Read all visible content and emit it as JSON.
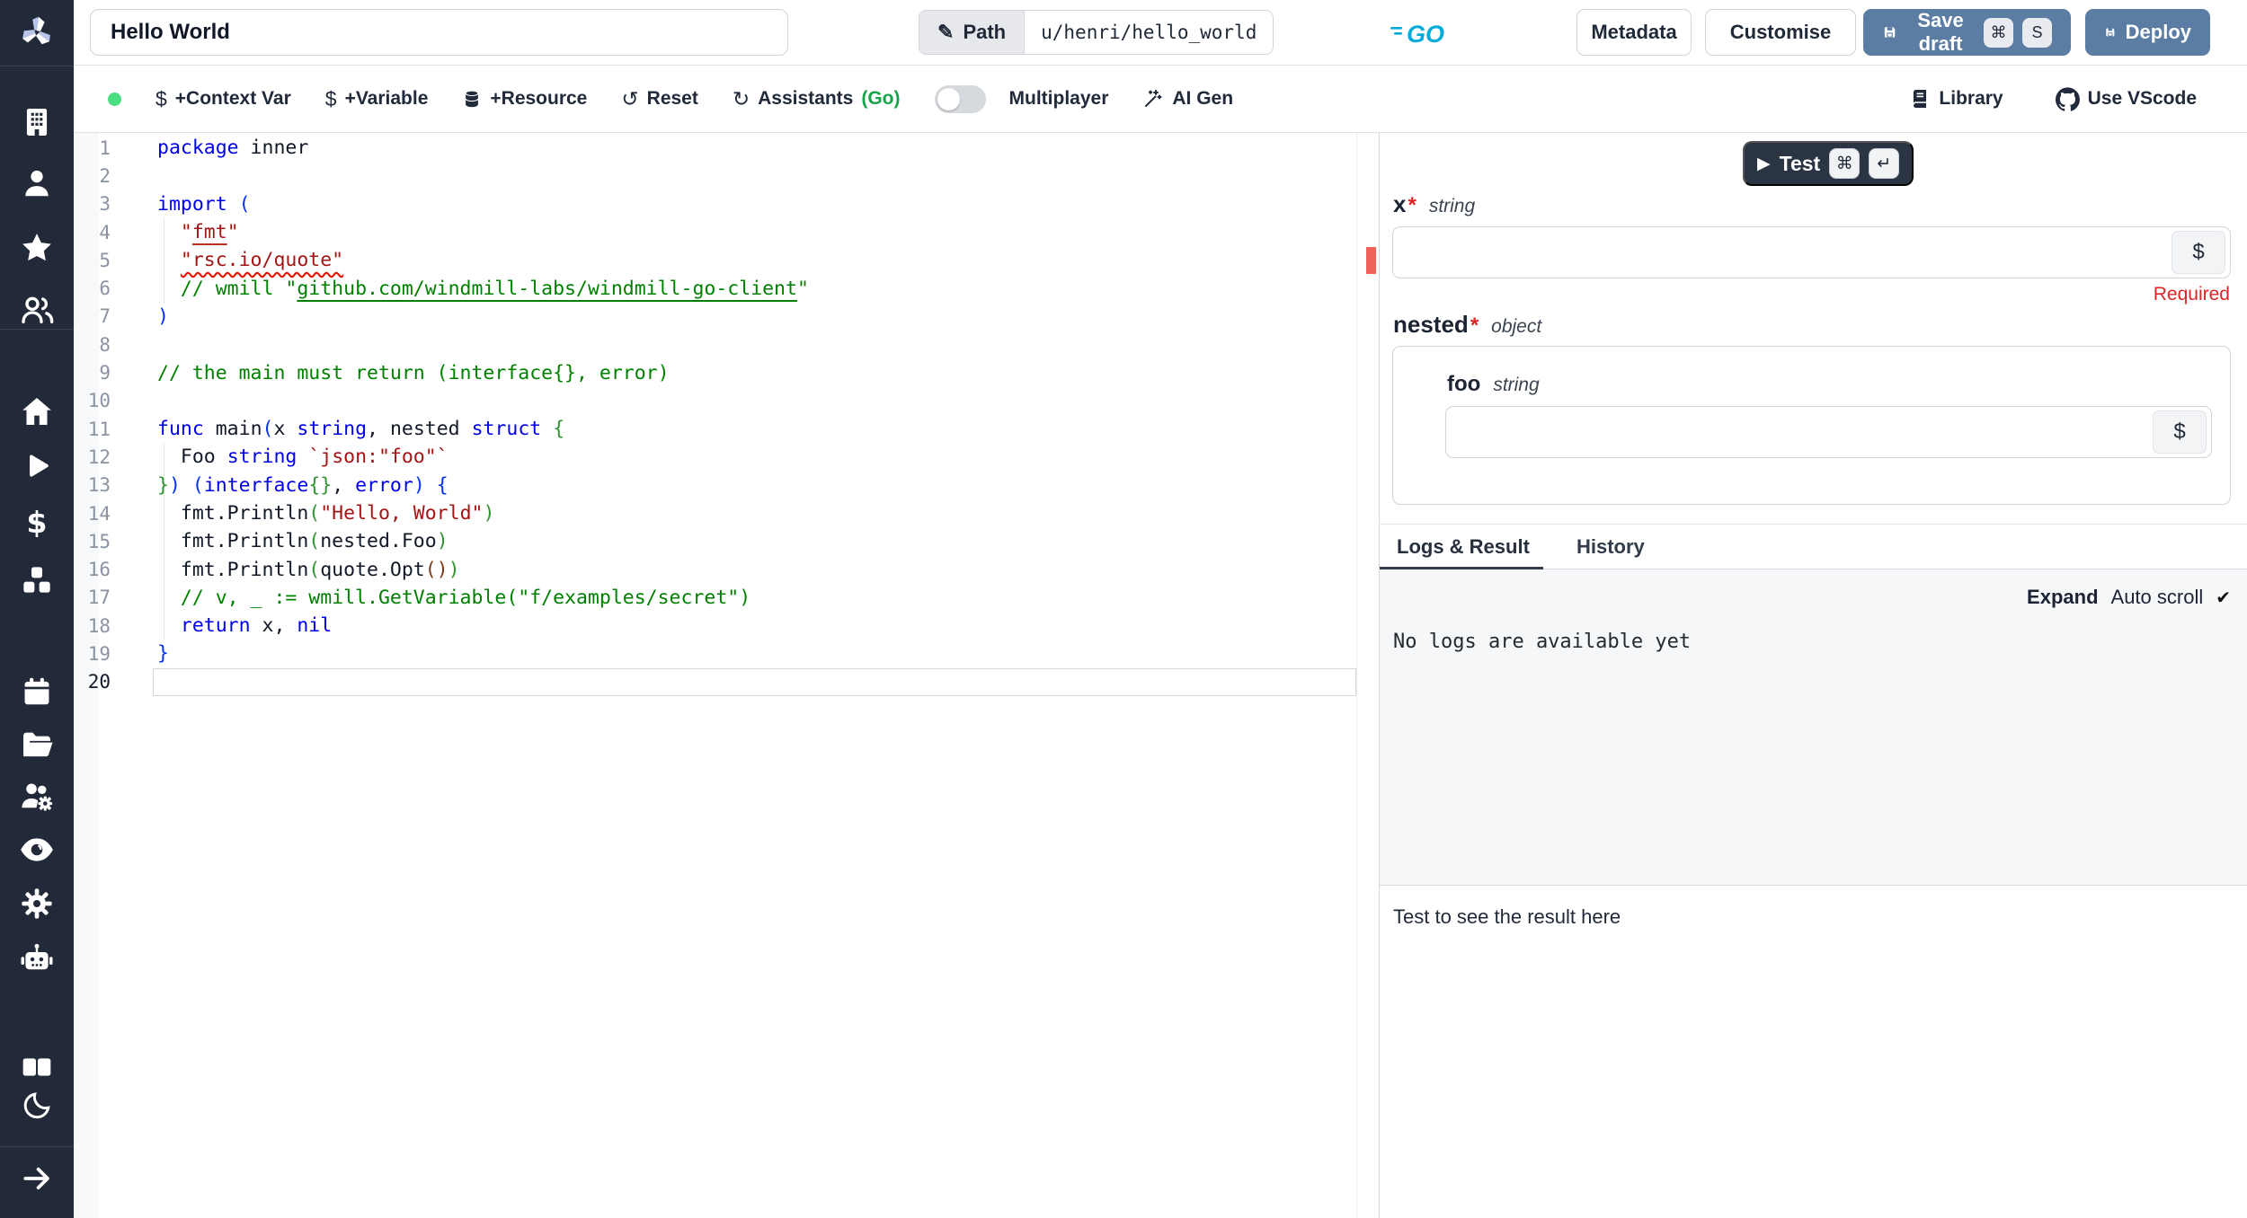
{
  "header": {
    "title_value": "Hello World",
    "path_label": "Path",
    "path_value": "u/henri/hello_world",
    "metadata_label": "Metadata",
    "customise_label": "Customise",
    "save_draft_label": "Save draft",
    "save_kbd_cmd": "⌘",
    "save_kbd_key": "S",
    "deploy_label": "Deploy"
  },
  "toolbar": {
    "context_var_label": "+Context Var",
    "variable_label": "+Variable",
    "resource_label": "+Resource",
    "reset_label": "Reset",
    "assistants_label": "Assistants",
    "assistants_lang": "(Go)",
    "multiplayer_label": "Multiplayer",
    "ai_gen_label": "AI Gen",
    "library_label": "Library",
    "vscode_label": "Use VScode",
    "dollar_glyph": "$",
    "reset_glyph": "↺",
    "assistants_glyph": "↻",
    "pencil_glyph": "✎"
  },
  "sidebar": {
    "icons_top": [
      "building",
      "user",
      "star",
      "users"
    ],
    "icons_workspace": [
      "home",
      "play",
      "dollar",
      "boxes"
    ],
    "icons_tools": [
      "calendar",
      "folder-open",
      "users-cog",
      "eye",
      "settings",
      "robot"
    ],
    "icons_bottom": [
      "book-open",
      "moon"
    ],
    "collapse_icon": "arrow-right"
  },
  "editor": {
    "lines": [
      {
        "n": 1,
        "s": [
          [
            "k",
            "package"
          ],
          [
            "d",
            " inner"
          ]
        ]
      },
      {
        "n": 2,
        "s": []
      },
      {
        "n": 3,
        "s": [
          [
            "k",
            "import"
          ],
          [
            "d",
            " "
          ],
          [
            "b1",
            "("
          ]
        ]
      },
      {
        "n": 4,
        "s": [
          [
            "d",
            "  "
          ],
          [
            "s",
            "\""
          ],
          [
            "su",
            "fmt"
          ],
          [
            "s",
            "\""
          ]
        ]
      },
      {
        "n": 5,
        "s": [
          [
            "d",
            "  "
          ],
          [
            "sw",
            "\"rsc.io/quote\""
          ]
        ]
      },
      {
        "n": 6,
        "s": [
          [
            "d",
            "  "
          ],
          [
            "c",
            "// wmill \""
          ],
          [
            "cu",
            "github.com/windmill-labs/windmill-go-client"
          ],
          [
            "c",
            "\""
          ]
        ]
      },
      {
        "n": 7,
        "s": [
          [
            "b1",
            ")"
          ]
        ]
      },
      {
        "n": 8,
        "s": []
      },
      {
        "n": 9,
        "s": [
          [
            "c",
            "// the main must return (interface{}, error)"
          ]
        ]
      },
      {
        "n": 10,
        "s": []
      },
      {
        "n": 11,
        "s": [
          [
            "k",
            "func"
          ],
          [
            "d",
            " "
          ],
          [
            "i",
            "main"
          ],
          [
            "b1",
            "("
          ],
          [
            "i",
            "x"
          ],
          [
            "d",
            " "
          ],
          [
            "k",
            "string"
          ],
          [
            "d",
            ", "
          ],
          [
            "i",
            "nested"
          ],
          [
            "d",
            " "
          ],
          [
            "k",
            "struct"
          ],
          [
            "d",
            " "
          ],
          [
            "b2",
            "{"
          ]
        ]
      },
      {
        "n": 12,
        "s": [
          [
            "d",
            "  "
          ],
          [
            "i",
            "Foo"
          ],
          [
            "d",
            " "
          ],
          [
            "k",
            "string"
          ],
          [
            "d",
            " "
          ],
          [
            "s",
            "`json:\"foo\"`"
          ]
        ]
      },
      {
        "n": 13,
        "s": [
          [
            "b2",
            "}"
          ],
          [
            "b1",
            ")"
          ],
          [
            "d",
            " "
          ],
          [
            "b1",
            "("
          ],
          [
            "k",
            "interface"
          ],
          [
            "b2",
            "{}"
          ],
          [
            "d",
            ", "
          ],
          [
            "k",
            "error"
          ],
          [
            "b1",
            ")"
          ],
          [
            "d",
            " "
          ],
          [
            "b1",
            "{"
          ]
        ]
      },
      {
        "n": 14,
        "s": [
          [
            "d",
            "  "
          ],
          [
            "i",
            "fmt.Println"
          ],
          [
            "b2",
            "("
          ],
          [
            "s",
            "\"Hello, World\""
          ],
          [
            "b2",
            ")"
          ]
        ]
      },
      {
        "n": 15,
        "s": [
          [
            "d",
            "  "
          ],
          [
            "i",
            "fmt.Println"
          ],
          [
            "b2",
            "("
          ],
          [
            "i",
            "nested.Foo"
          ],
          [
            "b2",
            ")"
          ]
        ]
      },
      {
        "n": 16,
        "s": [
          [
            "d",
            "  "
          ],
          [
            "i",
            "fmt.Println"
          ],
          [
            "b2",
            "("
          ],
          [
            "i",
            "quote.Opt"
          ],
          [
            "b3",
            "()"
          ],
          [
            "b2",
            ")"
          ]
        ]
      },
      {
        "n": 17,
        "s": [
          [
            "d",
            "  "
          ],
          [
            "c",
            "// v, _ := wmill.GetVariable(\"f/examples/secret\")"
          ]
        ]
      },
      {
        "n": 18,
        "s": [
          [
            "d",
            "  "
          ],
          [
            "k",
            "return"
          ],
          [
            "d",
            " "
          ],
          [
            "i",
            "x"
          ],
          [
            "d",
            ", "
          ],
          [
            "k",
            "nil"
          ]
        ]
      },
      {
        "n": 19,
        "s": [
          [
            "b1",
            "}"
          ]
        ]
      },
      {
        "n": 20,
        "s": [],
        "active": true
      }
    ]
  },
  "panel": {
    "test_label": "Test",
    "test_play_glyph": "▶",
    "kbd_cmd": "⌘",
    "kbd_enter": "↵",
    "arg_x": {
      "name": "x",
      "star": "*",
      "type": "string",
      "dollar": "$"
    },
    "required_hint": "Required",
    "arg_nested": {
      "name": "nested",
      "star": "*",
      "type": "object"
    },
    "arg_foo": {
      "name": "foo",
      "type": "string",
      "dollar": "$"
    },
    "tabs": {
      "logs": "Logs & Result",
      "history": "History"
    },
    "expand_label": "Expand",
    "autoscroll_label": "Auto scroll",
    "check_glyph": "✔",
    "no_logs_text": "No logs are available yet",
    "result_placeholder": "Test to see the result here"
  },
  "colors": {
    "accent_blue": "#5b7da3",
    "sidebar_bg": "#222938",
    "go_cyan": "#00acd7",
    "green_dot": "#4ade80",
    "assistants_green": "#16a34a",
    "error_red": "#dc2626",
    "marker_red": "#f0615a",
    "test_button_bg": "#2b3442"
  }
}
